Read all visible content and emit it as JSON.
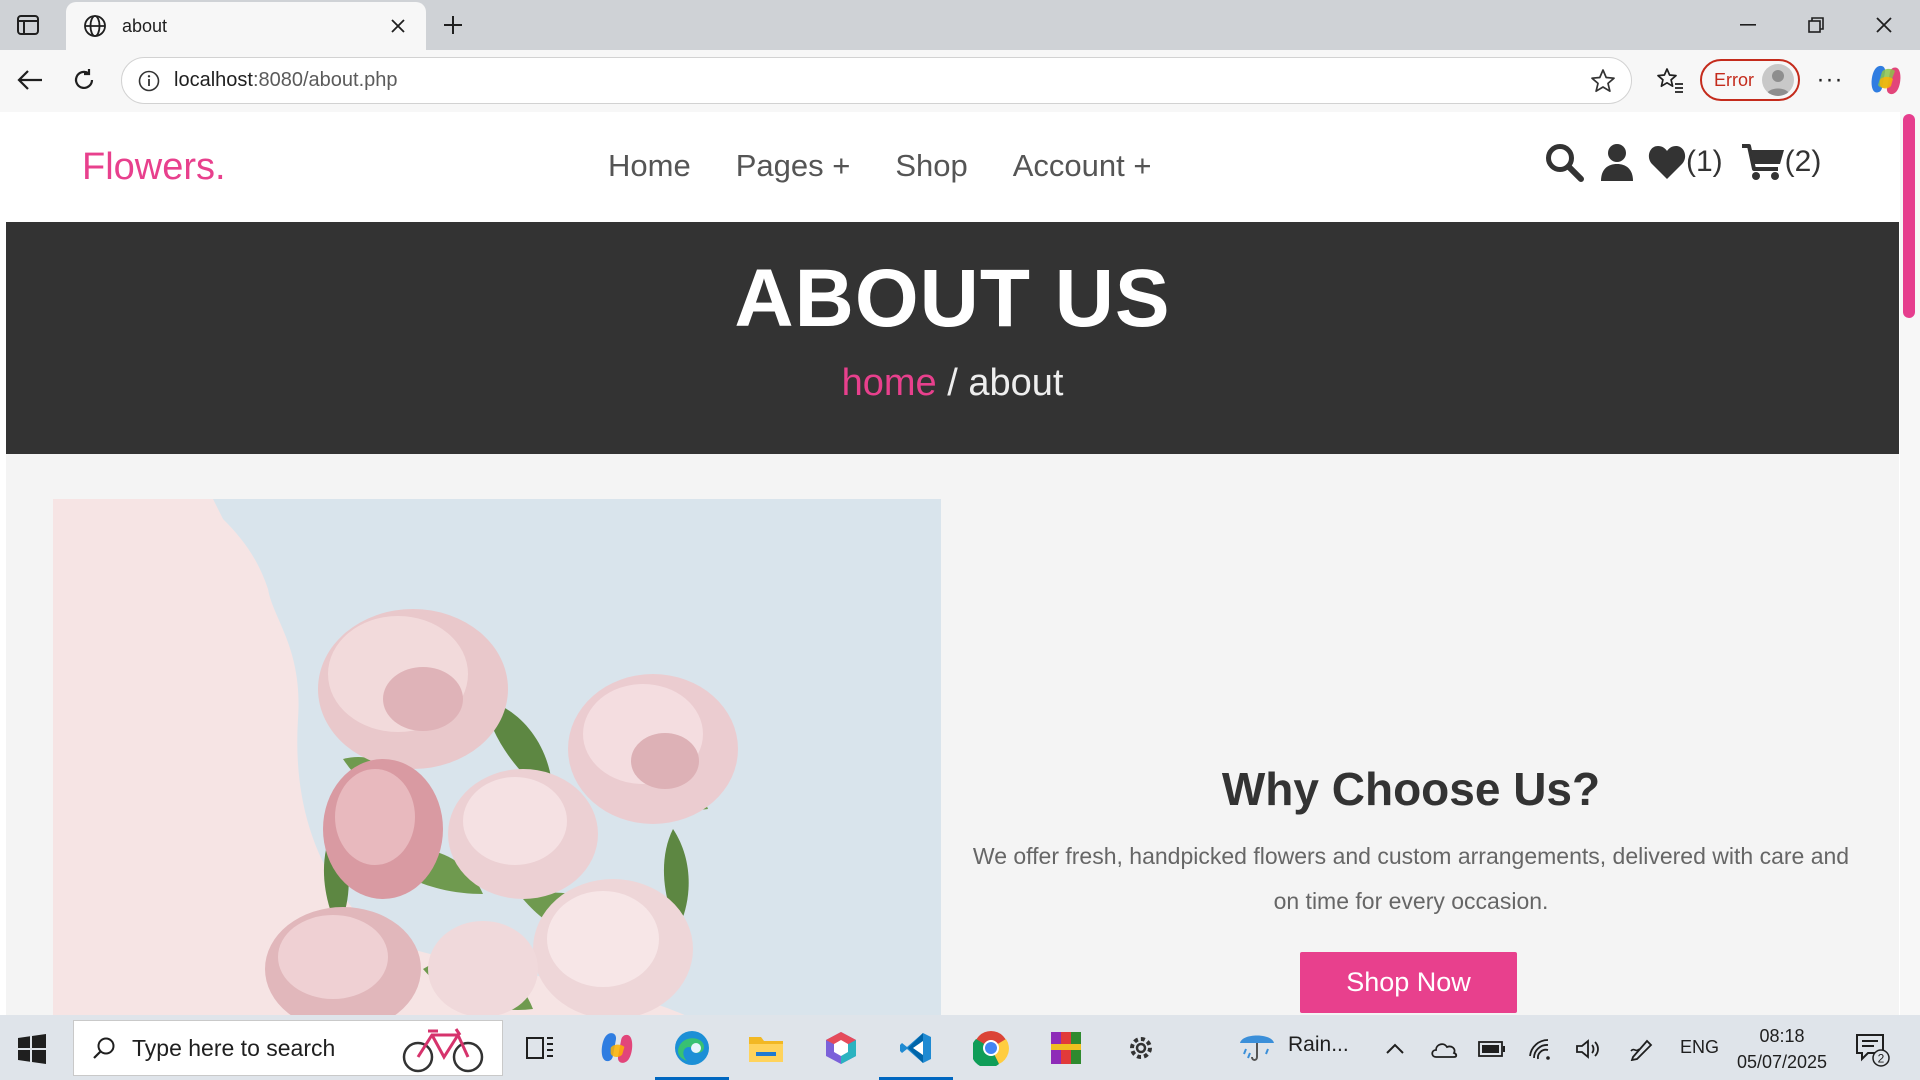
{
  "browser": {
    "tab_title": "about",
    "url_host": "localhost",
    "url_path": ":8080/about.php",
    "profile_status": "Error",
    "more_label": "···"
  },
  "site": {
    "logo": "Flowers.",
    "nav": [
      "Home",
      "Pages +",
      "Shop",
      "Account +"
    ],
    "wishlist_count": "(1)",
    "cart_count": "(2)",
    "accent_color": "#e8408d"
  },
  "banner": {
    "title": "ABOUT US",
    "crumb_home": "home",
    "crumb_separator": " / ",
    "crumb_current": "about"
  },
  "why": {
    "heading": "Why Choose Us?",
    "text": "We offer fresh, handpicked flowers and custom arrangements, delivered with care and on time for every occasion.",
    "button": "Shop Now"
  },
  "taskbar": {
    "search_placeholder": "Type here to search",
    "weather": "Rain...",
    "language": "ENG",
    "time": "08:18",
    "date": "05/07/2025",
    "notification_count": "2"
  }
}
